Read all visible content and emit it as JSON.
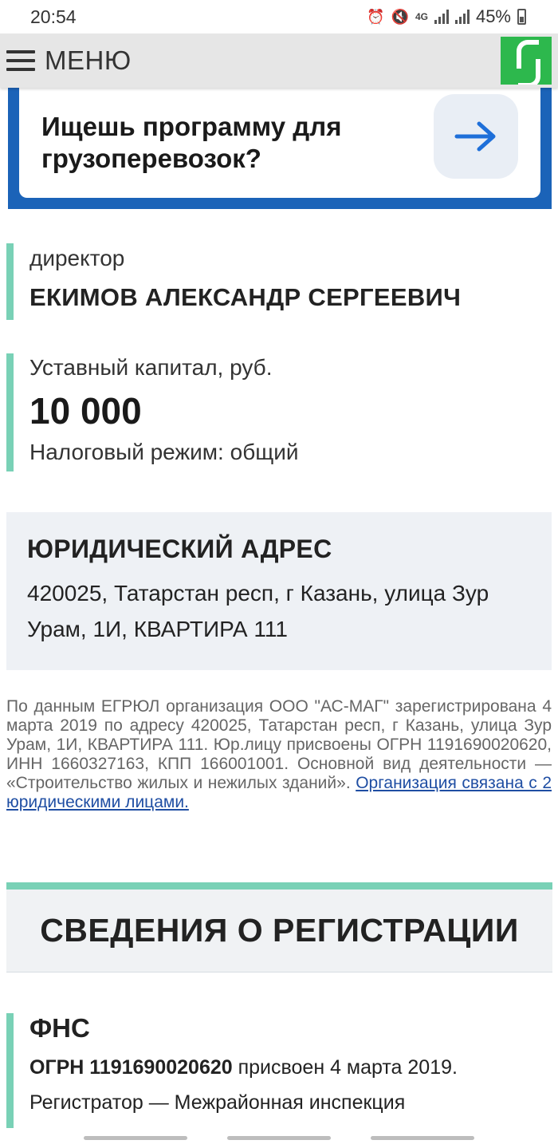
{
  "status_bar": {
    "time": "20:54",
    "network": "4G",
    "battery": "45%"
  },
  "header": {
    "menu_label": "МЕНЮ",
    "logo_icon": "s-logo-icon",
    "logo_color": "#2db84d"
  },
  "promo": {
    "text": "Ищешь программу для грузоперевозок?",
    "arrow_icon": "arrow-right-icon",
    "accent": "#1b63b8"
  },
  "director": {
    "label": "директор",
    "name": "ЕКИМОВ АЛЕКСАНДР СЕРГЕЕВИЧ"
  },
  "capital": {
    "label": "Уставный капитал, руб.",
    "value": "10 000",
    "tax_regime": "Налоговый режим: общий"
  },
  "address": {
    "title": "ЮРИДИЧЕСКИЙ АДРЕС",
    "text": "420025, Татарстан респ, г Казань, улица Зур Урам, 1И, КВАРТИРА 111"
  },
  "description": {
    "text": "По данным ЕГРЮЛ организация ООО \"АС-МАГ\" зарегистрирована 4 марта 2019 по адресу 420025, Татарстан респ, г Казань, улица Зур Урам, 1И, КВАРТИРА 111. Юр.лицу присвоены ОГРН 1191690020620, ИНН 1660327163, КПП 166001001. Основной вид деятельности — «Строительство жилых и нежилых зданий». ",
    "link": "Организация связана с 2 юридическими лицами."
  },
  "registration": {
    "title": "СВЕДЕНИЯ О РЕГИСТРАЦИИ"
  },
  "fns": {
    "title": "ФНС",
    "ogrn_prefix": "ОГРН 1191690020620",
    "ogrn_rest": " присвоен 4 марта 2019.",
    "registrar": "Регистратор — Межрайонная инспекция"
  },
  "colors": {
    "green_bar": "#79d1b6",
    "link": "#1f4ea3"
  }
}
